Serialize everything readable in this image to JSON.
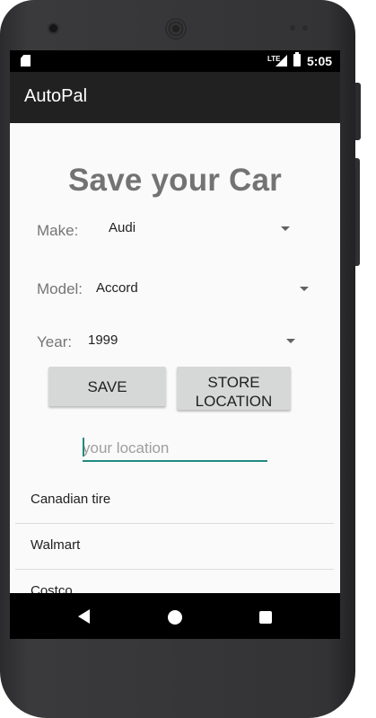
{
  "status_bar": {
    "network": "LTE",
    "time": "5:05"
  },
  "app_bar": {
    "title": "AutoPal"
  },
  "main": {
    "headline": "Save your Car",
    "make": {
      "label": "Make:",
      "value": "Audi"
    },
    "model": {
      "label": "Model:",
      "value": "Accord"
    },
    "year": {
      "label": "Year:",
      "value": "1999"
    },
    "save_button": "SAVE",
    "store_location_button": {
      "line1": "STORE",
      "line2": "LOCATION"
    },
    "location_input": {
      "placeholder": "your location",
      "value": ""
    },
    "locations": [
      "Canadian tire",
      "Walmart",
      "Costco"
    ]
  },
  "colors": {
    "app_bar": "#212121",
    "accent": "#1f8a82",
    "button": "#d6d7d7",
    "headline": "#737373"
  },
  "icons": {
    "status": [
      "sd-card-icon",
      "signal-icon",
      "battery-icon"
    ],
    "nav": [
      "back-icon",
      "home-icon",
      "recent-apps-icon"
    ]
  }
}
